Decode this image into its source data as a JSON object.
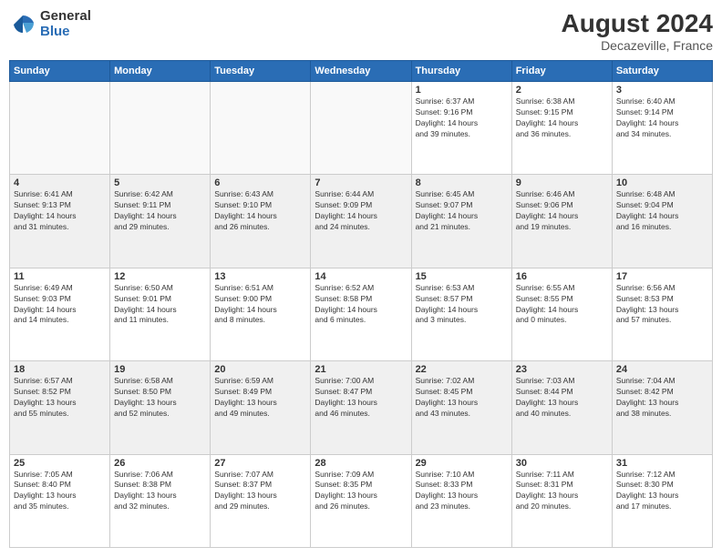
{
  "logo": {
    "general": "General",
    "blue": "Blue"
  },
  "title": "August 2024",
  "location": "Decazeville, France",
  "days_header": [
    "Sunday",
    "Monday",
    "Tuesday",
    "Wednesday",
    "Thursday",
    "Friday",
    "Saturday"
  ],
  "weeks": [
    [
      {
        "day": "",
        "info": ""
      },
      {
        "day": "",
        "info": ""
      },
      {
        "day": "",
        "info": ""
      },
      {
        "day": "",
        "info": ""
      },
      {
        "day": "1",
        "info": "Sunrise: 6:37 AM\nSunset: 9:16 PM\nDaylight: 14 hours\nand 39 minutes."
      },
      {
        "day": "2",
        "info": "Sunrise: 6:38 AM\nSunset: 9:15 PM\nDaylight: 14 hours\nand 36 minutes."
      },
      {
        "day": "3",
        "info": "Sunrise: 6:40 AM\nSunset: 9:14 PM\nDaylight: 14 hours\nand 34 minutes."
      }
    ],
    [
      {
        "day": "4",
        "info": "Sunrise: 6:41 AM\nSunset: 9:13 PM\nDaylight: 14 hours\nand 31 minutes."
      },
      {
        "day": "5",
        "info": "Sunrise: 6:42 AM\nSunset: 9:11 PM\nDaylight: 14 hours\nand 29 minutes."
      },
      {
        "day": "6",
        "info": "Sunrise: 6:43 AM\nSunset: 9:10 PM\nDaylight: 14 hours\nand 26 minutes."
      },
      {
        "day": "7",
        "info": "Sunrise: 6:44 AM\nSunset: 9:09 PM\nDaylight: 14 hours\nand 24 minutes."
      },
      {
        "day": "8",
        "info": "Sunrise: 6:45 AM\nSunset: 9:07 PM\nDaylight: 14 hours\nand 21 minutes."
      },
      {
        "day": "9",
        "info": "Sunrise: 6:46 AM\nSunset: 9:06 PM\nDaylight: 14 hours\nand 19 minutes."
      },
      {
        "day": "10",
        "info": "Sunrise: 6:48 AM\nSunset: 9:04 PM\nDaylight: 14 hours\nand 16 minutes."
      }
    ],
    [
      {
        "day": "11",
        "info": "Sunrise: 6:49 AM\nSunset: 9:03 PM\nDaylight: 14 hours\nand 14 minutes."
      },
      {
        "day": "12",
        "info": "Sunrise: 6:50 AM\nSunset: 9:01 PM\nDaylight: 14 hours\nand 11 minutes."
      },
      {
        "day": "13",
        "info": "Sunrise: 6:51 AM\nSunset: 9:00 PM\nDaylight: 14 hours\nand 8 minutes."
      },
      {
        "day": "14",
        "info": "Sunrise: 6:52 AM\nSunset: 8:58 PM\nDaylight: 14 hours\nand 6 minutes."
      },
      {
        "day": "15",
        "info": "Sunrise: 6:53 AM\nSunset: 8:57 PM\nDaylight: 14 hours\nand 3 minutes."
      },
      {
        "day": "16",
        "info": "Sunrise: 6:55 AM\nSunset: 8:55 PM\nDaylight: 14 hours\nand 0 minutes."
      },
      {
        "day": "17",
        "info": "Sunrise: 6:56 AM\nSunset: 8:53 PM\nDaylight: 13 hours\nand 57 minutes."
      }
    ],
    [
      {
        "day": "18",
        "info": "Sunrise: 6:57 AM\nSunset: 8:52 PM\nDaylight: 13 hours\nand 55 minutes."
      },
      {
        "day": "19",
        "info": "Sunrise: 6:58 AM\nSunset: 8:50 PM\nDaylight: 13 hours\nand 52 minutes."
      },
      {
        "day": "20",
        "info": "Sunrise: 6:59 AM\nSunset: 8:49 PM\nDaylight: 13 hours\nand 49 minutes."
      },
      {
        "day": "21",
        "info": "Sunrise: 7:00 AM\nSunset: 8:47 PM\nDaylight: 13 hours\nand 46 minutes."
      },
      {
        "day": "22",
        "info": "Sunrise: 7:02 AM\nSunset: 8:45 PM\nDaylight: 13 hours\nand 43 minutes."
      },
      {
        "day": "23",
        "info": "Sunrise: 7:03 AM\nSunset: 8:44 PM\nDaylight: 13 hours\nand 40 minutes."
      },
      {
        "day": "24",
        "info": "Sunrise: 7:04 AM\nSunset: 8:42 PM\nDaylight: 13 hours\nand 38 minutes."
      }
    ],
    [
      {
        "day": "25",
        "info": "Sunrise: 7:05 AM\nSunset: 8:40 PM\nDaylight: 13 hours\nand 35 minutes."
      },
      {
        "day": "26",
        "info": "Sunrise: 7:06 AM\nSunset: 8:38 PM\nDaylight: 13 hours\nand 32 minutes."
      },
      {
        "day": "27",
        "info": "Sunrise: 7:07 AM\nSunset: 8:37 PM\nDaylight: 13 hours\nand 29 minutes."
      },
      {
        "day": "28",
        "info": "Sunrise: 7:09 AM\nSunset: 8:35 PM\nDaylight: 13 hours\nand 26 minutes."
      },
      {
        "day": "29",
        "info": "Sunrise: 7:10 AM\nSunset: 8:33 PM\nDaylight: 13 hours\nand 23 minutes."
      },
      {
        "day": "30",
        "info": "Sunrise: 7:11 AM\nSunset: 8:31 PM\nDaylight: 13 hours\nand 20 minutes."
      },
      {
        "day": "31",
        "info": "Sunrise: 7:12 AM\nSunset: 8:30 PM\nDaylight: 13 hours\nand 17 minutes."
      }
    ]
  ]
}
